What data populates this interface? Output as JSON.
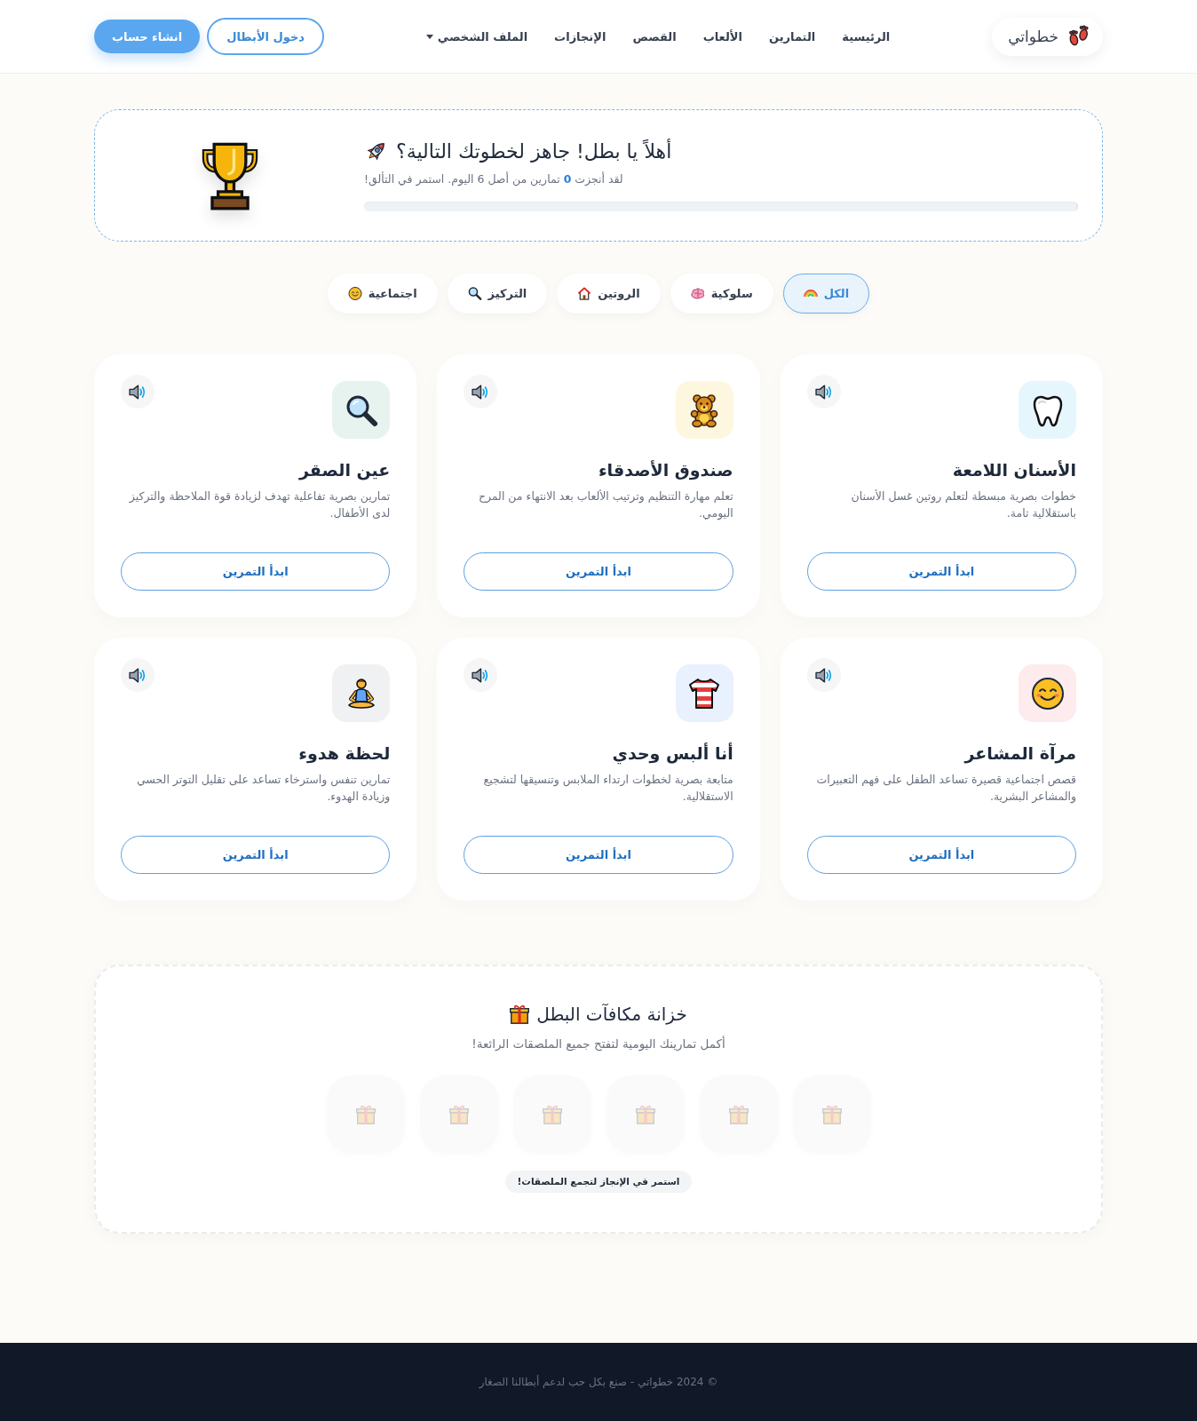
{
  "header": {
    "brand": "خطواتي",
    "nav": [
      {
        "label": "الرئيسية",
        "has_menu": false
      },
      {
        "label": "التمارين",
        "has_menu": false
      },
      {
        "label": "الألعاب",
        "has_menu": false
      },
      {
        "label": "القصص",
        "has_menu": false
      },
      {
        "label": "الإنجازات",
        "has_menu": false
      },
      {
        "label": "الملف الشخصي",
        "has_menu": true
      }
    ],
    "buttons": [
      {
        "label": "دخول الأبطال",
        "kind": "outline"
      },
      {
        "label": "انشاء حساب",
        "kind": "primary"
      }
    ]
  },
  "hero": {
    "title": "أهلاً يا بطل! جاهز لخطوتك التالية؟",
    "subtitle": "لقد أنجزت **0** تمارين من أصل 6 اليوم. استمر في التألق!",
    "level": 0
  },
  "filters": [
    {
      "label": "الكل",
      "selected": true
    },
    {
      "label": "سلوكية",
      "selected": false
    },
    {
      "label": "الروتين",
      "selected": false
    },
    {
      "label": "التركيز",
      "selected": false
    },
    {
      "label": "اجتماعية",
      "selected": false
    }
  ],
  "exercises": [
    {
      "title": "الأسنان اللامعة",
      "description": "خطوات بصرية مبسطة لتعلم روتين غسل الأسنان باستقلالية تامة.",
      "button": "ابدأ التمرين",
      "color": "#e6f6fd"
    },
    {
      "title": "صندوق الأصدقاء",
      "description": "تعلم مهارة التنظيم وترتيب الألعاب بعد الانتهاء من المرح اليومي.",
      "button": "ابدأ التمرين",
      "color": "#fef7e0"
    },
    {
      "title": "عين الصقر",
      "description": "تمارين بصرية تفاعلية تهدف لزيادة قوة الملاحظة والتركيز لدى الأطفال.",
      "button": "ابدأ التمرين",
      "color": "#e7f3ee"
    },
    {
      "title": "مرآة المشاعر",
      "description": "قصص اجتماعية قصيرة تساعد الطفل على فهم التعبيرات والمشاعر البشرية.",
      "button": "ابدأ التمرين",
      "color": "#fdebee"
    },
    {
      "title": "أنا ألبس وحدي",
      "description": "متابعة بصرية لخطوات ارتداء الملابس وتنسيقها لتشجيع الاستقلالية.",
      "button": "ابدأ التمرين",
      "color": "#e8f1fd"
    },
    {
      "title": "لحظة هدوء",
      "description": "تمارين تنفس واسترخاء تساعد على تقليل التوتر الحسي وزيادة الهدوء.",
      "button": "ابدأ التمرين",
      "color": "#eff1f3"
    }
  ],
  "rewards": {
    "title": "خزانة مكافآت البطل",
    "subtitle": "أكمل تمارينك اليومية لتفتح جميع الملصقات الرائعة!",
    "stickers": [
      {
        "unlocked": false
      },
      {
        "unlocked": false
      },
      {
        "unlocked": false
      },
      {
        "unlocked": false
      },
      {
        "unlocked": false
      },
      {
        "unlocked": false
      }
    ],
    "note": "استمر في الإنجاز لتجمع الملصقات!"
  },
  "footer": {
    "text": "© 2024 خطواتي - صنع بكل حب لدعم أبطالنا الصغار"
  }
}
